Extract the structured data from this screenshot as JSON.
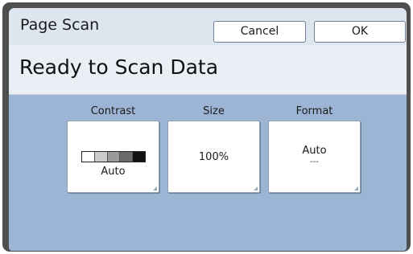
{
  "header": {
    "title": "Page Scan",
    "cancel_label": "Cancel",
    "ok_label": "OK"
  },
  "status": {
    "message": "Ready to Scan Data"
  },
  "settings": {
    "contrast": {
      "label": "Contrast",
      "value": "Auto",
      "scale_colors": [
        "#ffffff",
        "#cccccc",
        "#9a9a9a",
        "#6a6a6a",
        "#111111"
      ]
    },
    "size": {
      "label": "Size",
      "value": "100%"
    },
    "format": {
      "label": "Format",
      "value": "Auto",
      "sub": "---"
    }
  },
  "colors": {
    "panel_background": "#9cb5d5",
    "header_background": "#dde5ef",
    "bezel": "#4f4f4f"
  }
}
